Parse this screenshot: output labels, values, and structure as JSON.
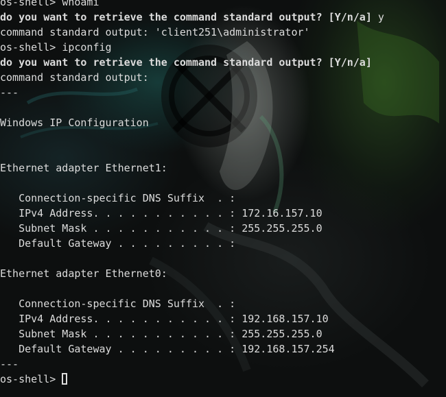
{
  "terminal": {
    "lines": [
      {
        "prompt": "os-shell>",
        "command": "whoami"
      },
      {
        "question": "do you want to retrieve the command standard output? [Y/n/a]",
        "answer": "y"
      },
      {
        "text": "command standard output: 'client251\\administrator'"
      },
      {
        "prompt": "os-shell>",
        "command": "ipconfig"
      },
      {
        "question": "do you want to retrieve the command standard output? [Y/n/a]"
      },
      {
        "text": "command standard output:"
      },
      {
        "text": "---"
      },
      {
        "text": ""
      },
      {
        "text": "Windows IP Configuration"
      },
      {
        "text": ""
      },
      {
        "text": ""
      },
      {
        "text": "Ethernet adapter Ethernet1:"
      },
      {
        "text": ""
      },
      {
        "text": "   Connection-specific DNS Suffix  . :"
      },
      {
        "text": "   IPv4 Address. . . . . . . . . . . : 172.16.157.10"
      },
      {
        "text": "   Subnet Mask . . . . . . . . . . . : 255.255.255.0"
      },
      {
        "text": "   Default Gateway . . . . . . . . . :"
      },
      {
        "text": ""
      },
      {
        "text": "Ethernet adapter Ethernet0:"
      },
      {
        "text": ""
      },
      {
        "text": "   Connection-specific DNS Suffix  . :"
      },
      {
        "text": "   IPv4 Address. . . . . . . . . . . : 192.168.157.10"
      },
      {
        "text": "   Subnet Mask . . . . . . . . . . . : 255.255.255.0"
      },
      {
        "text": "   Default Gateway . . . . . . . . . : 192.168.157.254"
      },
      {
        "text": "---"
      },
      {
        "prompt": "os-shell>",
        "command": ""
      }
    ]
  },
  "colors": {
    "background": "#0b0c0c",
    "foreground": "#dcdcdc"
  },
  "icons": {
    "cursor": "cursor-block-icon"
  }
}
